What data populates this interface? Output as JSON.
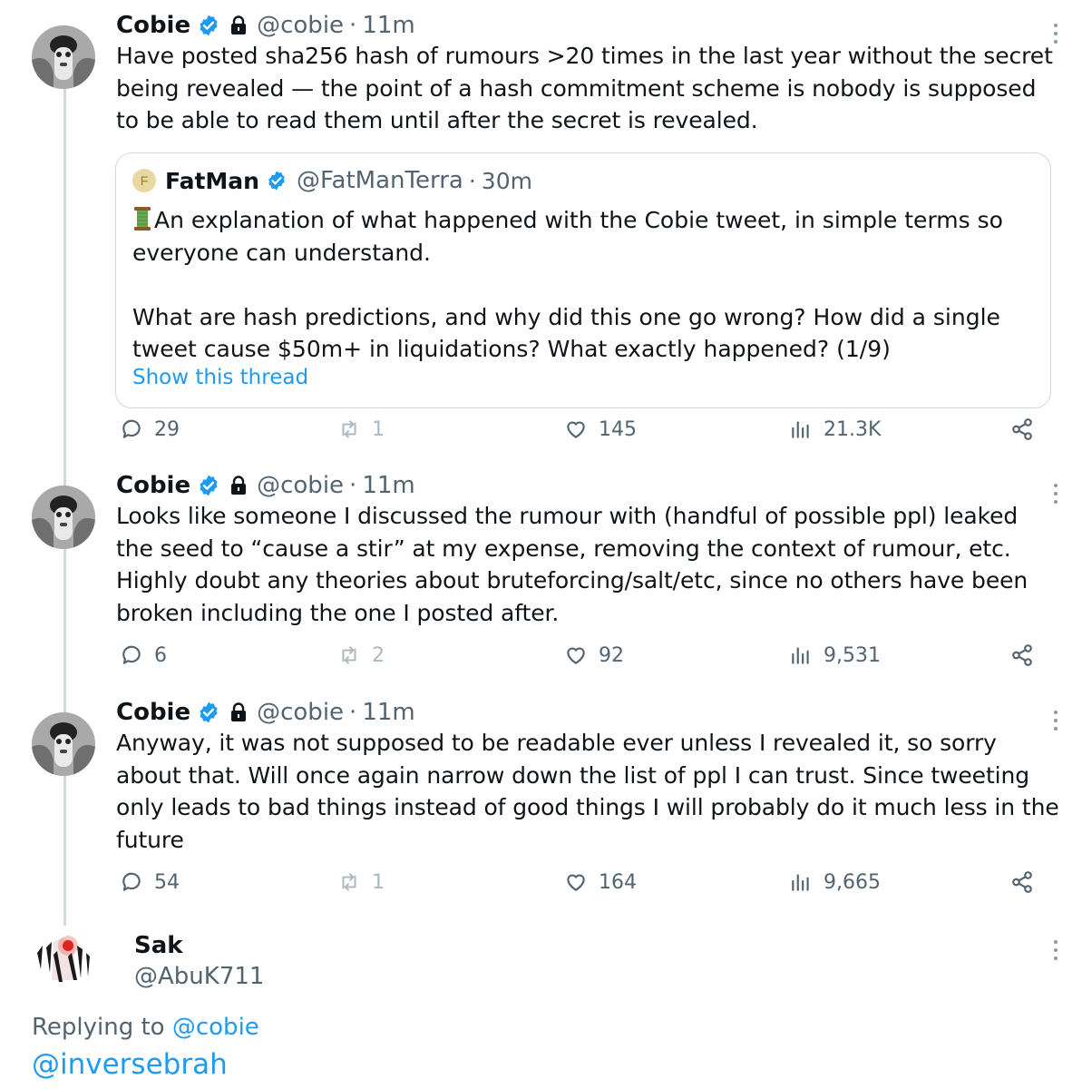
{
  "tweets": [
    {
      "name": "Cobie",
      "handle": "@cobie",
      "time": "11m",
      "text": "Have posted sha256 hash of rumours >20 times in the last year without the secret\nbeing revealed — the point of a hash commitment scheme is nobody is supposed\nto be able to read them until after the secret is revealed.",
      "quote": {
        "avatar_letter": "F",
        "name": "FatMan",
        "handle": "@FatManTerra",
        "time": "30m",
        "text": "An explanation of what happened with the Cobie tweet, in simple terms so\neveryone can understand.\n\nWhat are hash predictions, and why did this one go wrong? How did a single\ntweet cause $50m+ in liquidations? What exactly happened? (1/9)",
        "show_thread": "Show this thread"
      },
      "replies": "29",
      "retweets": "1",
      "likes": "145",
      "views": "21.3K"
    },
    {
      "name": "Cobie",
      "handle": "@cobie",
      "time": "11m",
      "text": "Looks like someone I discussed the rumour with (handful of possible ppl) leaked\nthe seed to “cause a stir” at my expense, removing the context of rumour, etc.\nHighly doubt any theories about bruteforcing/salt/etc, since no others have been\nbroken including the one I posted after.",
      "replies": "6",
      "retweets": "2",
      "likes": "92",
      "views": "9,531"
    },
    {
      "name": "Cobie",
      "handle": "@cobie",
      "time": "11m",
      "text": "Anyway, it was not supposed to be readable ever unless I revealed it, so sorry\nabout that. Will once again narrow down the list of ppl I can trust. Since tweeting\nonly leads to bad things instead of good things I will probably do it much less in the\nfuture",
      "replies": "54",
      "retweets": "1",
      "likes": "164",
      "views": "9,665"
    }
  ],
  "reply": {
    "name": "Sak",
    "handle": "@AbuK711",
    "replying_prefix": "Replying to ",
    "replying_to": "@cobie",
    "text": "@inversebrah"
  },
  "separator": "·",
  "icons": {
    "verified": "verified-badge-icon",
    "lock": "lock-icon",
    "reply": "reply-icon",
    "retweet": "retweet-icon",
    "like": "heart-icon",
    "views": "views-bars-icon",
    "share": "share-icon",
    "more": "more-options-icon",
    "thread": "spool-thread-icon"
  },
  "colors": {
    "link": "#1d9bf0",
    "secondary_text": "#536471",
    "verified": "#1d9bf0",
    "border": "#cfd9de"
  }
}
